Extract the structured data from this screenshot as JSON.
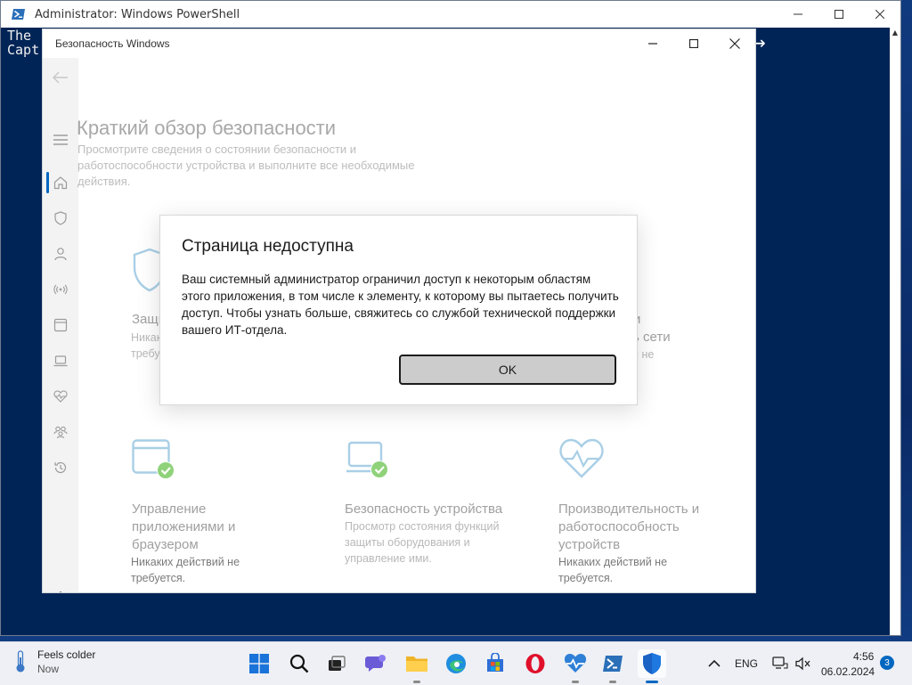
{
  "powershell": {
    "title": "Administrator: Windows PowerShell",
    "lines": [
      "The",
      "Capt"
    ]
  },
  "security": {
    "window_title": "Безопасность Windows",
    "page_title": "Краткий обзор безопасности",
    "page_subtitle": "Просмотрите сведения о состоянии безопасности и работоспособности устройства и выполните все необходимые действия.",
    "tiles": {
      "virus": {
        "title": "Защи",
        "desc": [
          "Никак",
          "требу"
        ]
      },
      "network": {
        "title": "и",
        "title2": "ь сети",
        "desc": "и не"
      },
      "apps": {
        "title": [
          "Управление",
          "приложениями и",
          "браузером"
        ],
        "desc": [
          "Никаких действий не",
          "требуется."
        ]
      },
      "device": {
        "title": "Безопасность устройства",
        "desc": [
          "Просмотр состояния функций",
          "защиты оборудования и",
          "управление ими."
        ]
      },
      "performance": {
        "title": [
          "Производительность и",
          "работоспособность",
          "устройств"
        ],
        "desc": [
          "Никаких действий не",
          "требуется."
        ]
      }
    }
  },
  "dialog": {
    "title": "Страница недоступна",
    "text": "Ваш системный администратор ограничил доступ к некоторым областям этого приложения, в том числе к элементу, к которому вы пытаетесь получить доступ. Чтобы узнать больше, свяжитесь со службой технической поддержки вашего ИТ-отдела.",
    "ok_label": "OK"
  },
  "taskbar": {
    "weather_main": "Feels colder",
    "weather_sub": "Now",
    "language": "ENG",
    "time": "4:56",
    "date": "06.02.2024",
    "notification_count": "3"
  },
  "colors": {
    "accent": "#0067c0",
    "ps_background": "#012456",
    "check_green": "#6cc04a",
    "tile_blue": "#a9cfe6"
  }
}
